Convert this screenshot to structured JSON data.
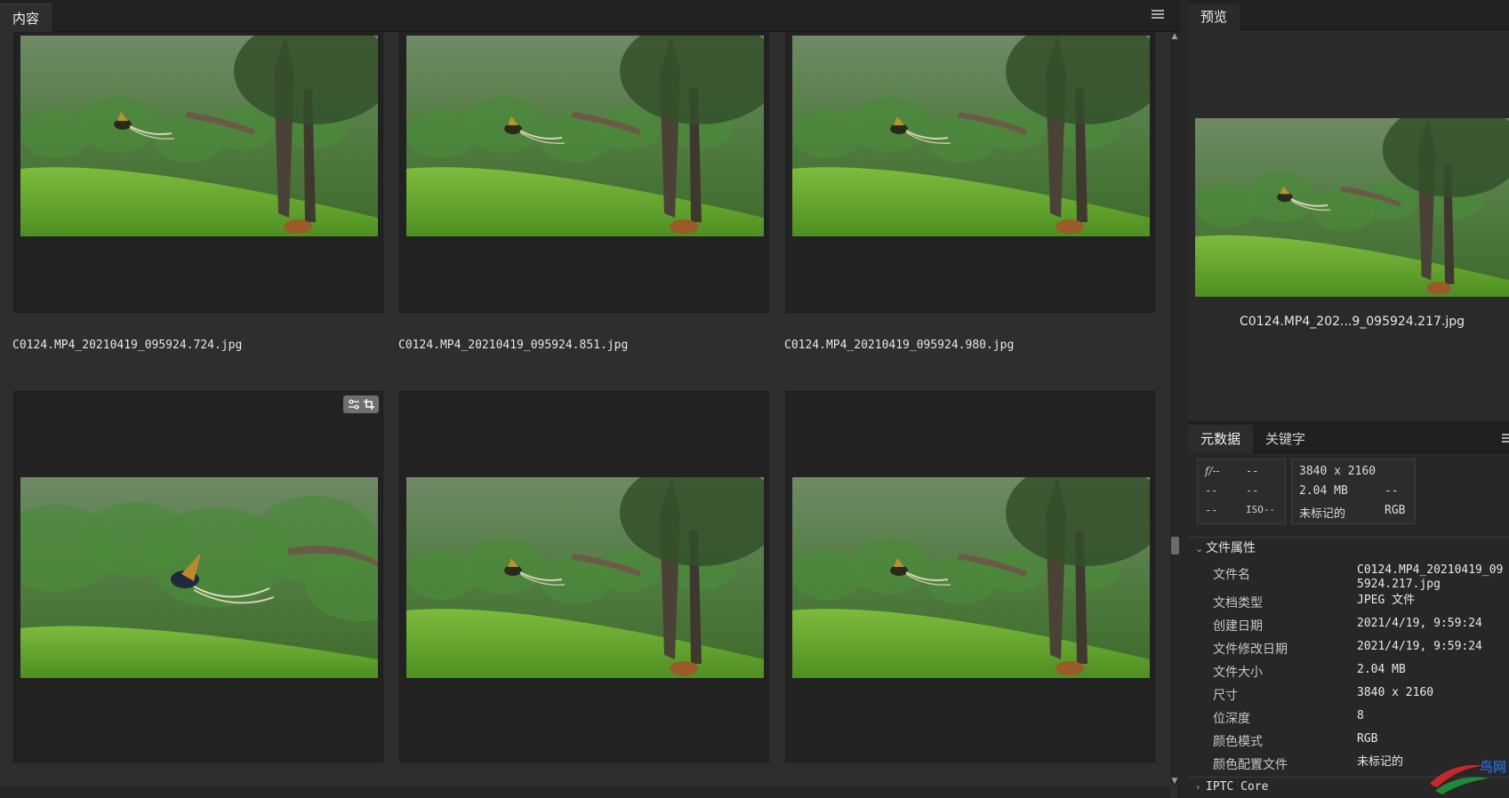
{
  "content_panel": {
    "tab_label": "内容",
    "thumbnails": [
      {
        "filename": "C0124.MP4_20210419_095924.724.jpg",
        "variant": "a"
      },
      {
        "filename": "C0124.MP4_20210419_095924.851.jpg",
        "variant": "b"
      },
      {
        "filename": "C0124.MP4_20210419_095924.980.jpg",
        "variant": "b"
      },
      {
        "filename": "",
        "variant": "close",
        "badge": true
      },
      {
        "filename": "",
        "variant": "b"
      },
      {
        "filename": "",
        "variant": "b"
      }
    ]
  },
  "preview_panel": {
    "tab_label": "预览",
    "caption": "C0124.MP4_202...9_095924.217.jpg"
  },
  "metadata_panel": {
    "tabs": [
      "元数据",
      "关键字"
    ],
    "camera": {
      "fstop": "f/--",
      "shutter": "--",
      "r2c1": "--",
      "r2c2": "--",
      "r3c1": "--",
      "iso": "ISO--"
    },
    "file_summary": {
      "dimensions": "3840 x 2160",
      "size": "2.04 MB",
      "r2c2": "--",
      "color_profile": "未标记的",
      "color_mode": "RGB"
    },
    "file_props_header": "文件属性",
    "file_props": [
      {
        "key": "文件名",
        "value": "C0124.MP4_20210419_095924.217.jpg"
      },
      {
        "key": "文档类型",
        "value": "JPEG 文件"
      },
      {
        "key": "创建日期",
        "value": "2021/4/19, 9:59:24"
      },
      {
        "key": "文件修改日期",
        "value": "2021/4/19, 9:59:24"
      },
      {
        "key": "文件大小",
        "value": "2.04 MB"
      },
      {
        "key": "尺寸",
        "value": "3840 x 2160"
      },
      {
        "key": "位深度",
        "value": "8"
      },
      {
        "key": "颜色模式",
        "value": "RGB"
      },
      {
        "key": "颜色配置文件",
        "value": "未标记的"
      }
    ],
    "iptc_header": "IPTC Core"
  },
  "watermark": {
    "text": "鸟网",
    "colors": [
      "#c8282a",
      "#1e8a3a",
      "#2a5fb8"
    ]
  }
}
